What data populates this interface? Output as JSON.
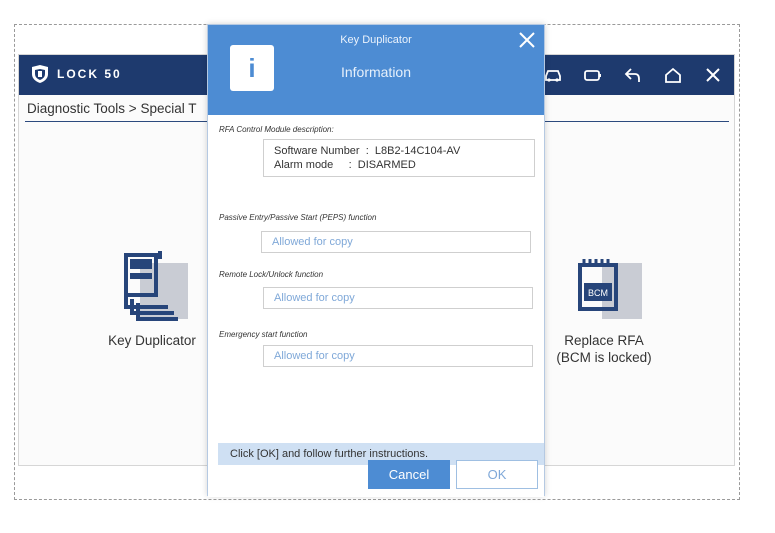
{
  "app": {
    "brand": "LOCK 50",
    "breadcrumb": "Diagnostic Tools > Special T"
  },
  "tiles": {
    "left_label": "Key Duplicator",
    "right_label_1": "Replace RFA",
    "right_label_2": "(BCM is locked)",
    "bcm_text": "BCM"
  },
  "dialog": {
    "title": "Key Duplicator",
    "subtitle": "Information",
    "info_glyph": "i",
    "rfa_label": "RFA Control Module description:",
    "software_line": "Software Number  :  L8B2-14C104-AV",
    "alarm_line": "Alarm mode     :  DISARMED",
    "peps_label": "Passive Entry/Passive Start (PEPS) function",
    "peps_value": "Allowed for copy",
    "remote_label": "Remote Lock/Unlock function",
    "remote_value": "Allowed for copy",
    "emergency_label": "Emergency start function",
    "emergency_value": "Allowed for copy",
    "hint": "Click [OK] and follow further instructions.",
    "cancel_label": "Cancel",
    "ok_label": "OK"
  },
  "colors": {
    "header": "#1e3a6e",
    "dialog_accent": "#4d8cd3",
    "hint_bg": "#cfe0f3"
  }
}
